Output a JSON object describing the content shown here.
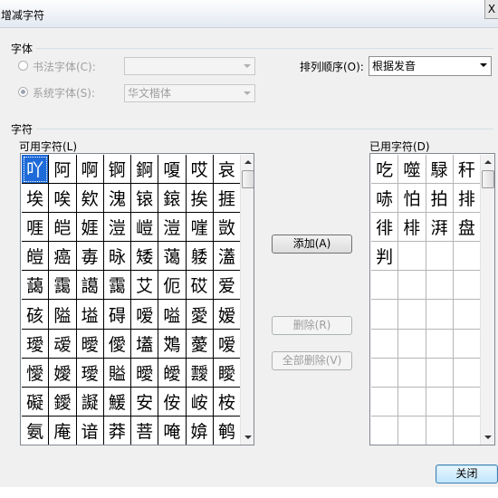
{
  "window": {
    "title": "增减字符",
    "close_label": "X"
  },
  "font_group": {
    "label": "字体",
    "calligraphy_label": "书法字体(C):",
    "calligraphy_value": "",
    "system_label": "系统字体(S):",
    "system_value": "华文楷体"
  },
  "sort": {
    "label": "排列顺序(O):",
    "value": "根据发音"
  },
  "char_group": {
    "label": "字符"
  },
  "available": {
    "label": "可用字符(L)",
    "rows": [
      [
        "吖",
        "阿",
        "啊",
        "锕",
        "錒",
        "嗄",
        "哎",
        "哀"
      ],
      [
        "埃",
        "唉",
        "欸",
        "溾",
        "锿",
        "鎄",
        "挨",
        "捱"
      ],
      [
        "啀",
        "皑",
        "娾",
        "溰",
        "嵦",
        "溰",
        "嘊",
        "敳"
      ],
      [
        "皚",
        "癌",
        "毐",
        "昹",
        "矮",
        "蔼",
        "躷",
        "濭"
      ],
      [
        "藹",
        "靄",
        "譪",
        "靄",
        "艾",
        "伌",
        "砹",
        "爱"
      ],
      [
        "硋",
        "隘",
        "塧",
        "碍",
        "嗳",
        "嗌",
        "愛",
        "嫒"
      ],
      [
        "璦",
        "叆",
        "曖",
        "僾",
        "壒",
        "鴱",
        "薆",
        "嗳"
      ],
      [
        "懓",
        "嬡",
        "璦",
        "賹",
        "曖",
        "皧",
        "靉",
        "瞹"
      ],
      [
        "礙",
        "鑀",
        "譺",
        "鰀",
        "安",
        "侒",
        "峖",
        "桉"
      ],
      [
        "氨",
        "庵",
        "谙",
        "莽",
        "菩",
        "唵",
        "媕",
        "鹌"
      ]
    ]
  },
  "used": {
    "label": "已用字符(D)",
    "rows": [
      [
        "吃",
        "噬",
        "騄",
        "秆"
      ],
      [
        "哧",
        "怕",
        "拍",
        "排"
      ],
      [
        "徘",
        "棑",
        "湃",
        "盘"
      ],
      [
        "判",
        "",
        "",
        ""
      ],
      [
        "",
        "",
        "",
        ""
      ],
      [
        "",
        "",
        "",
        ""
      ],
      [
        "",
        "",
        "",
        ""
      ],
      [
        "",
        "",
        "",
        ""
      ],
      [
        "",
        "",
        "",
        ""
      ],
      [
        "",
        "",
        "",
        ""
      ]
    ]
  },
  "buttons": {
    "add": "添加(A)",
    "remove": "删除(R)",
    "remove_all": "全部删除(V)",
    "close": "关闭"
  }
}
